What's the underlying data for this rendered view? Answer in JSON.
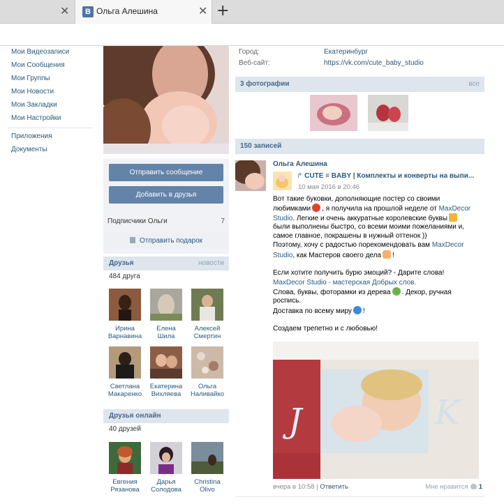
{
  "browser": {
    "tab_title": "Ольга Алешина",
    "favicon_letter": "В",
    "close_glyph": "✕",
    "new_tab_glyph": "+"
  },
  "left_menu": {
    "items": [
      "Мои Видеозаписи",
      "Мои Сообщения",
      "Мои Группы",
      "Мои Новости",
      "Мои Закладки",
      "Мои Настройки"
    ],
    "extra": [
      "Приложения",
      "Документы"
    ]
  },
  "profile": {
    "send_message": "Отправить сообщение",
    "add_friend": "Добавить в друзья",
    "subscribers_label": "Подписчики Ольги",
    "subscribers_count": "7",
    "send_gift": "Отправить подарок"
  },
  "friends": {
    "title": "Друзья",
    "more": "новости",
    "count": "484 друга",
    "items": [
      {
        "first": "Ирина",
        "last": "Варнавина"
      },
      {
        "first": "Елена",
        "last": "Шила"
      },
      {
        "first": "Алексей",
        "last": "Смертин"
      },
      {
        "first": "Светлана",
        "last": "Макаренко"
      },
      {
        "first": "Екатерина",
        "last": "Вихляева"
      },
      {
        "first": "Ольга",
        "last": "Наливайко"
      }
    ]
  },
  "friends_online": {
    "title": "Друзья онлайн",
    "count": "40 друзей",
    "items": [
      {
        "first": "Евгения",
        "last": "Рязанова"
      },
      {
        "first": "Дарья",
        "last": "Солодова"
      },
      {
        "first": "Christina",
        "last": "Olivo"
      }
    ]
  },
  "info": {
    "city_label": "Город:",
    "city_value": "Екатеринбург",
    "site_label": "Веб-сайт:",
    "site_value": "https://vk.com/cute_baby_studio"
  },
  "photos": {
    "title": "3 фотографии",
    "all": "все"
  },
  "wall": {
    "title": "150 записей",
    "author": "Ольга Алешина",
    "repost_title": "CUTE ≡ BABY | Комплекты и конверты на выпи...",
    "repost_date": "10 мая 2016 в 20:46",
    "text": {
      "l1": "Вот такие буковки, дополняющие постер со своими",
      "l2a": "любимками",
      "l2b": ", я получила на прошлой неделе от",
      "l2link": "MaxDecor",
      "l3link": "Studio",
      "l3b": ". Легкие и очень аккуратные королевские буквы",
      "l4": "были выполнены быстро, со всеми моими пожеланиями и,",
      "l5": "самое главное, покрашены в нужный оттенок ))",
      "l6": "Поэтому, хочу с радостью порекомендовать вам",
      "l6link": "MaxDecor",
      "l7link": "Studio",
      "l7b": ", как Мастеров своего дела",
      "l7c": "!",
      "l8": "Если хотите получить бурю эмоций? - Дарите слова!",
      "l9link": "MaxDecor Studio",
      "l9b": "- мастерская Добрых слов.",
      "l10a": "Слова, буквы, фоторамки из дерева",
      "l10b": ". Декор, ручная",
      "l11": "роспись.",
      "l12a": "Доставка по всему миру",
      "l12b": "!",
      "l13": "Создаем трепетно и с любовью!"
    },
    "footer_time": "вчера в 10:58",
    "footer_sep": "|",
    "reply": "Ответить",
    "likes_label": "Мне нравится",
    "likes_count": "1"
  }
}
